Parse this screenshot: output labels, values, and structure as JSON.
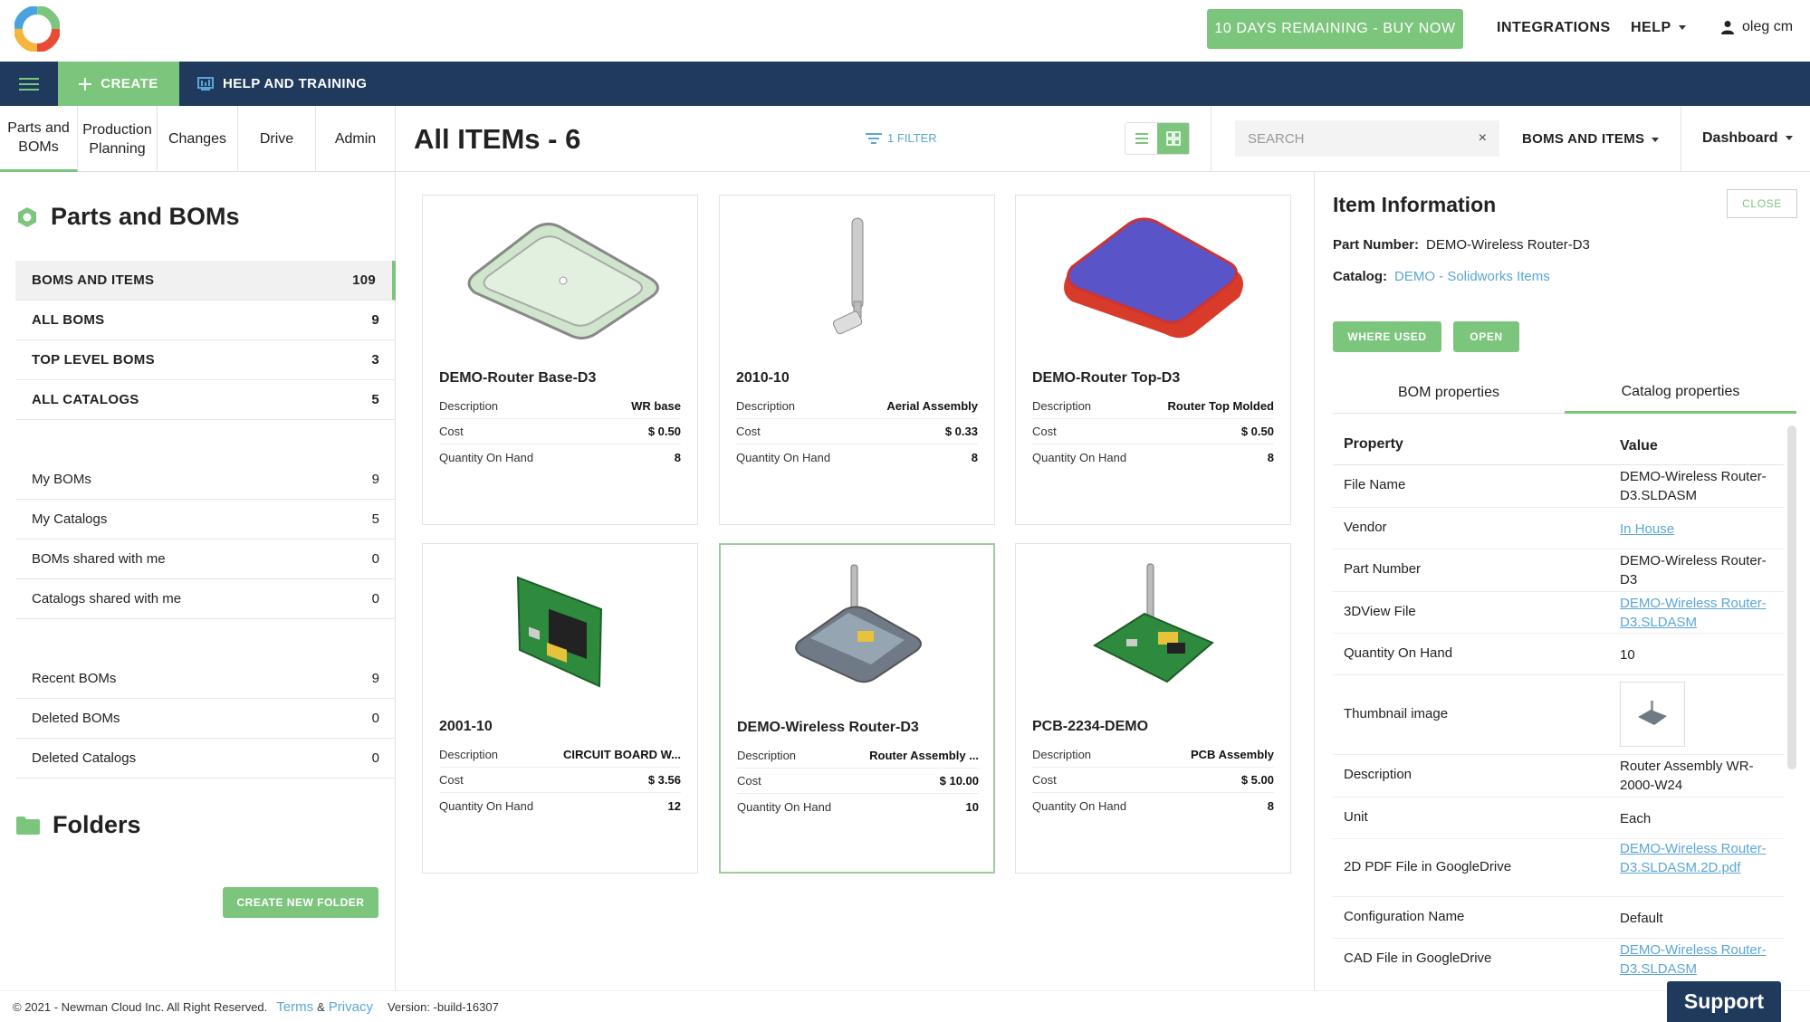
{
  "header": {
    "trial_label": "10 DAYS REMAINING - BUY NOW",
    "integrations": "INTEGRATIONS",
    "help": "HELP",
    "user": "oleg cm"
  },
  "toolbar": {
    "create": "CREATE",
    "help_training": "HELP AND TRAINING"
  },
  "nav_tabs": [
    {
      "label": "Parts and BOMs"
    },
    {
      "label": "Production Planning"
    },
    {
      "label": "Changes"
    },
    {
      "label": "Drive"
    },
    {
      "label": "Admin"
    }
  ],
  "sidebar": {
    "title": "Parts and BOMs",
    "main_items": [
      {
        "label": "BOMS AND ITEMS",
        "count": "109"
      },
      {
        "label": "ALL BOMS",
        "count": "9"
      },
      {
        "label": "TOP LEVEL BOMS",
        "count": "3"
      },
      {
        "label": "ALL CATALOGS",
        "count": "5"
      }
    ],
    "my_items": [
      {
        "label": "My BOMs",
        "count": "9"
      },
      {
        "label": "My Catalogs",
        "count": "5"
      },
      {
        "label": "BOMs shared with me",
        "count": "0"
      },
      {
        "label": "Catalogs shared with me",
        "count": "0"
      }
    ],
    "recent_items": [
      {
        "label": "Recent BOMs",
        "count": "9"
      },
      {
        "label": "Deleted BOMs",
        "count": "0"
      },
      {
        "label": "Deleted Catalogs",
        "count": "0"
      }
    ],
    "folders_title": "Folders",
    "new_folder": "CREATE NEW FOLDER"
  },
  "content": {
    "title": "All ITEMs - 6",
    "filter": "1 FILTER",
    "search_placeholder": "SEARCH",
    "search_clear": "×",
    "scope": "BOMS AND ITEMS",
    "dashboard": "Dashboard"
  },
  "item_labels": {
    "description": "Description",
    "cost": "Cost",
    "qty": "Quantity On Hand"
  },
  "items": [
    {
      "name": "DEMO-Router Base-D3",
      "description": "WR base",
      "cost": "$ 0.50",
      "qty": "8"
    },
    {
      "name": "2010-10",
      "description": "Aerial Assembly",
      "cost": "$ 0.33",
      "qty": "8"
    },
    {
      "name": "DEMO-Router Top-D3",
      "description": "Router Top Molded",
      "cost": "$ 0.50",
      "qty": "8"
    },
    {
      "name": "2001-10",
      "description": "CIRCUIT BOARD W...",
      "cost": "$ 3.56",
      "qty": "12"
    },
    {
      "name": "DEMO-Wireless Router-D3",
      "description": "Router Assembly ...",
      "cost": "$ 10.00",
      "qty": "10"
    },
    {
      "name": "PCB-2234-DEMO",
      "description": "PCB Assembly",
      "cost": "$ 5.00",
      "qty": "8"
    }
  ],
  "info": {
    "title": "Item Information",
    "close": "CLOSE",
    "part_number_label": "Part Number:",
    "part_number": "DEMO-Wireless Router-D3",
    "catalog_label": "Catalog:",
    "catalog": "DEMO - Solidworks Items",
    "where_used": "WHERE USED",
    "open": "OPEN",
    "tabs": [
      "BOM properties",
      "Catalog properties"
    ],
    "col_property": "Property",
    "col_value": "Value",
    "properties": [
      {
        "key": "File Name",
        "value": "DEMO-Wireless Router-D3.SLDASM"
      },
      {
        "key": "Vendor",
        "value": "In House"
      },
      {
        "key": "Part Number",
        "value": "DEMO-Wireless Router-D3"
      },
      {
        "key": "3DView File",
        "value": "DEMO-Wireless Router-D3.SLDASM"
      },
      {
        "key": "Quantity On Hand",
        "value": "10"
      },
      {
        "key": "Thumbnail image",
        "value": ""
      },
      {
        "key": "Description",
        "value": "Router Assembly WR-2000-W24"
      },
      {
        "key": "Unit",
        "value": "Each"
      },
      {
        "key": "2D PDF File in GoogleDrive",
        "value": "DEMO-Wireless Router-D3.SLDASM.2D.pdf"
      },
      {
        "key": "Configuration Name",
        "value": "Default"
      },
      {
        "key": "CAD File in GoogleDrive",
        "value": "DEMO-Wireless Router-D3.SLDASM"
      }
    ]
  },
  "footer": {
    "copyright": "© 2021 - Newman Cloud Inc. All Right Reserved.",
    "terms": "Terms",
    "amp": "&",
    "privacy": "Privacy",
    "version": "Version: -build-16307"
  },
  "support": "Support",
  "colors": {
    "accent": "#7cc57d",
    "navy": "#1f3a5c",
    "link": "#5aa6d6"
  }
}
